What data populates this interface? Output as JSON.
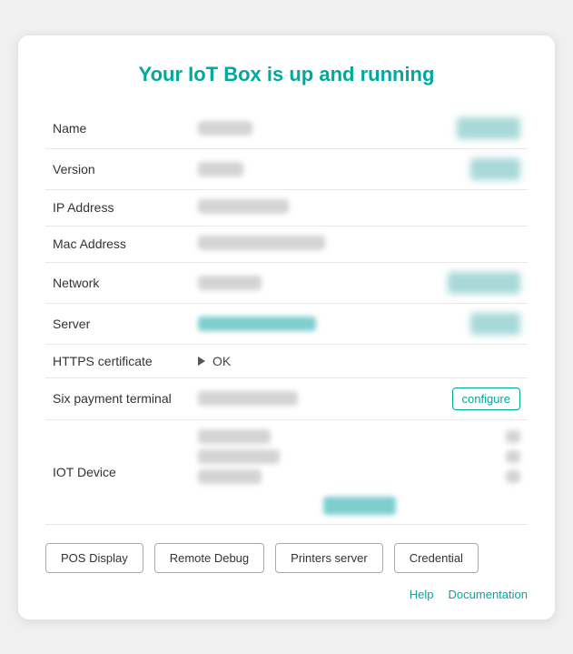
{
  "title": "Your IoT Box is up and running",
  "fields": [
    {
      "label": "Name",
      "value_width": 60,
      "has_right_btn": true,
      "right_btn_width": 70,
      "type": "gray"
    },
    {
      "label": "Version",
      "value_width": 50,
      "has_right_btn": true,
      "right_btn_width": 55,
      "type": "gray"
    },
    {
      "label": "IP Address",
      "value_width": 100,
      "has_right_btn": false,
      "type": "gray"
    },
    {
      "label": "Mac Address",
      "value_width": 140,
      "has_right_btn": false,
      "type": "gray"
    },
    {
      "label": "Network",
      "value_width": 70,
      "has_right_btn": true,
      "right_btn_width": 80,
      "type": "gray"
    },
    {
      "label": "Server",
      "value_width": 130,
      "has_right_btn": true,
      "right_btn_width": 55,
      "type": "teal"
    },
    {
      "label": "HTTPS certificate",
      "type": "https"
    },
    {
      "label": "Six payment terminal",
      "value_width": 110,
      "has_right_btn": false,
      "type": "gray",
      "has_configure": true
    },
    {
      "label": "IOT Device",
      "type": "iot"
    }
  ],
  "https_text": "OK",
  "configure_label": "configure",
  "iot_rows": [
    {
      "left_width": 80,
      "right_width": 16
    },
    {
      "left_width": 90,
      "right_width": 16
    },
    {
      "left_width": 70,
      "right_width": 16
    }
  ],
  "footer_buttons": [
    {
      "label": "POS Display"
    },
    {
      "label": "Remote Debug"
    },
    {
      "label": "Printers server"
    },
    {
      "label": "Credential"
    }
  ],
  "bottom_links": [
    {
      "label": "Help",
      "href": "#"
    },
    {
      "label": "Documentation",
      "href": "#"
    }
  ]
}
